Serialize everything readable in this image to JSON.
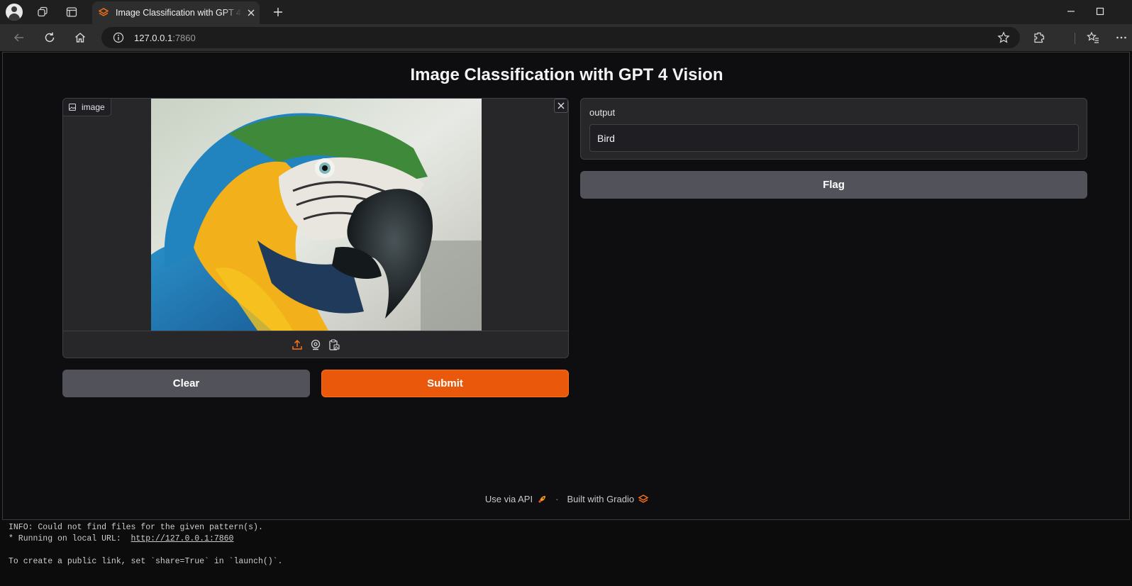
{
  "browser": {
    "tab_title": "Image Classification with GPT 4 Vision",
    "url_host": "127.0.0.1",
    "url_port": ":7860"
  },
  "app": {
    "title": "Image Classification with GPT 4 Vision",
    "image_input": {
      "label": "image",
      "tools": [
        "upload-icon",
        "webcam-icon",
        "clipboard-icon"
      ]
    },
    "clear_label": "Clear",
    "submit_label": "Submit",
    "output": {
      "label": "output",
      "value": "Bird"
    },
    "flag_label": "Flag",
    "footer": {
      "api_label": "Use via API",
      "separator": "·",
      "built_label": "Built with Gradio"
    },
    "colors": {
      "accent": "#ea580c",
      "panel": "#27272a",
      "background": "#0e0e10"
    }
  },
  "console": {
    "line1": "INFO: Could not find files for the given pattern(s).",
    "line2_prefix": "* Running on local URL:  ",
    "line2_link": "http://127.0.0.1:7860",
    "line3": "To create a public link, set `share=True` in `launch()`."
  }
}
